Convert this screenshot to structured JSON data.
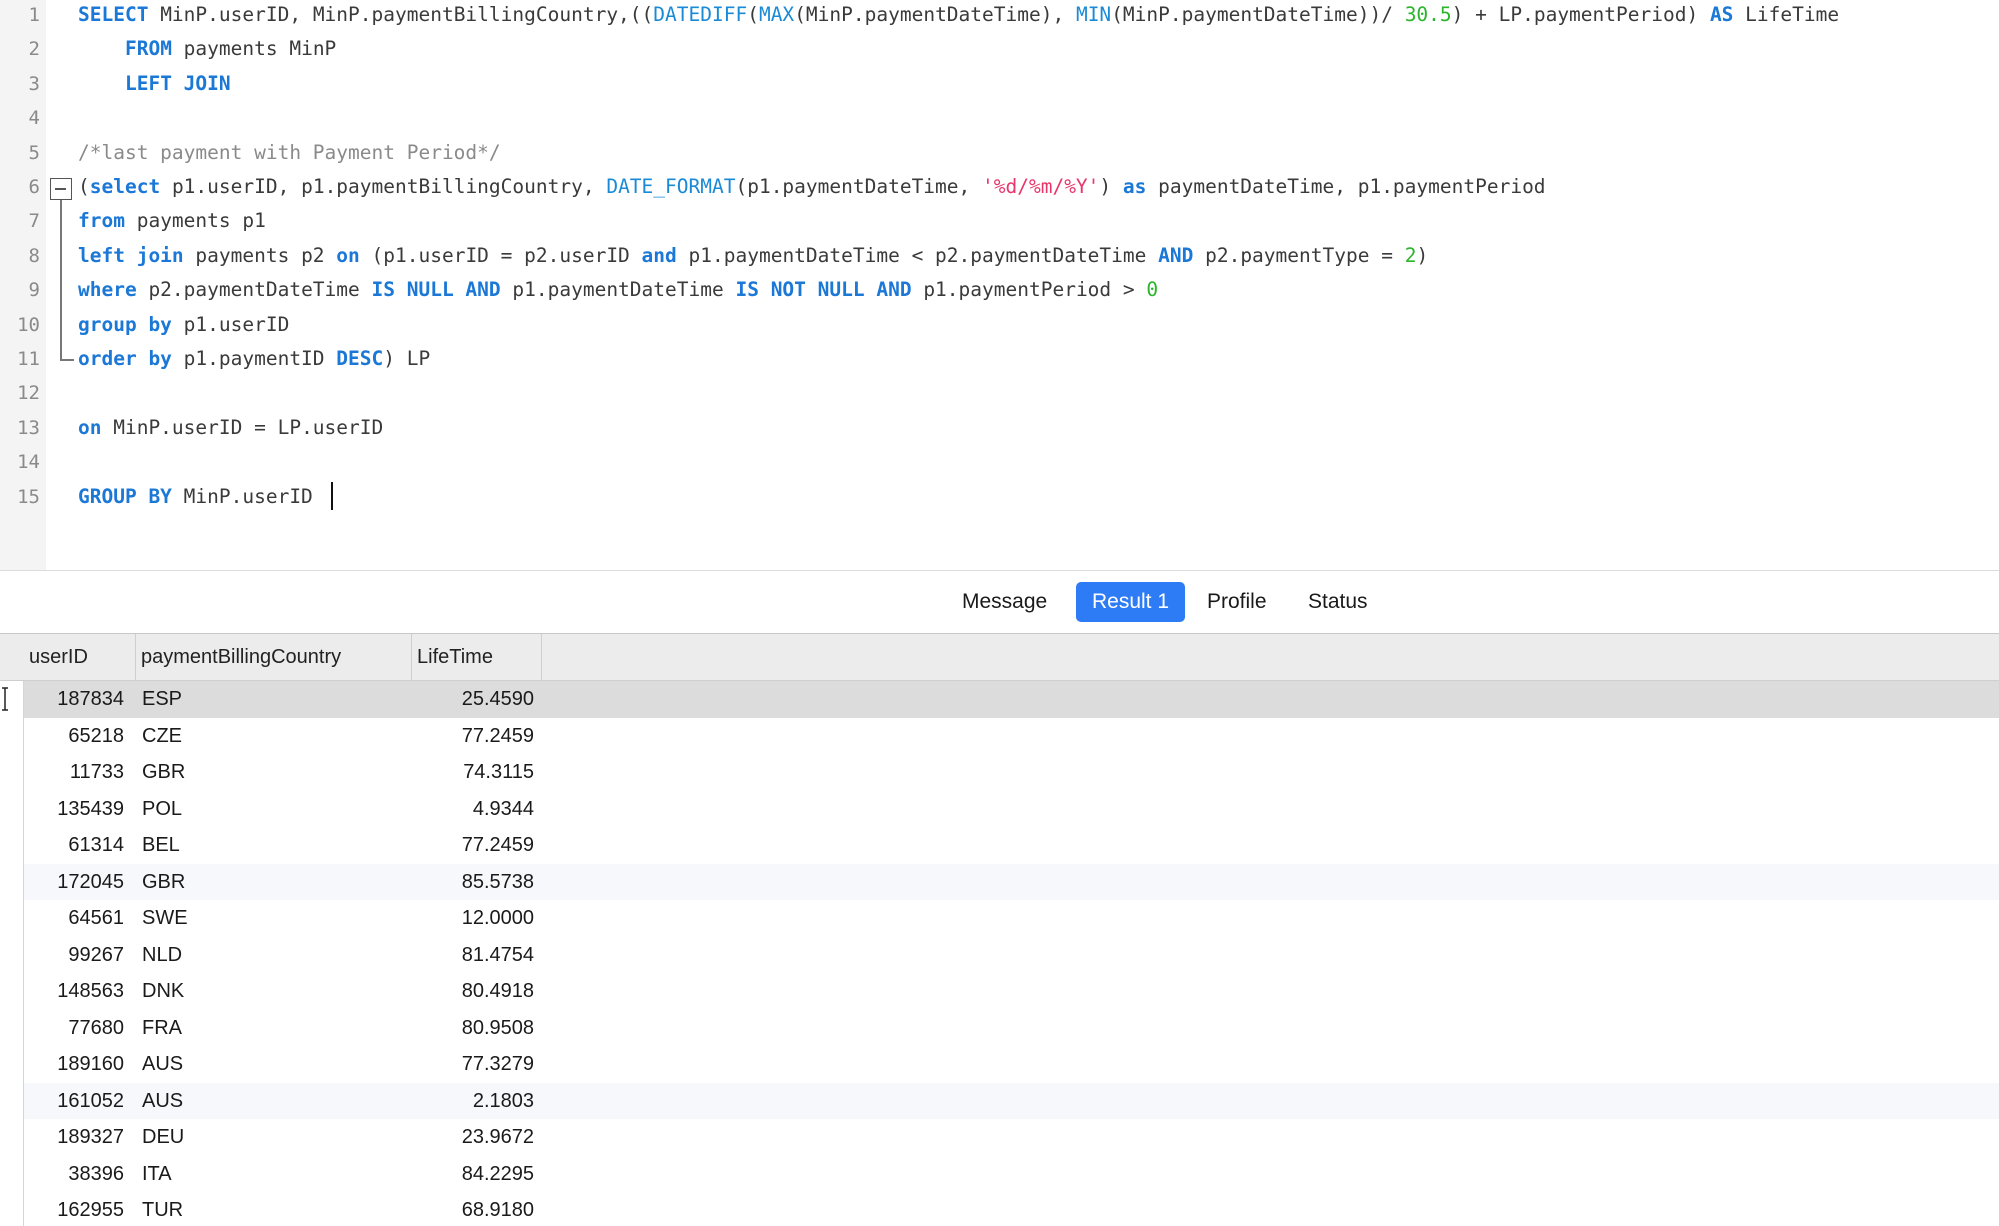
{
  "editor": {
    "line_numbers": [
      "1",
      "2",
      "3",
      "4",
      "5",
      "6",
      "7",
      "8",
      "9",
      "10",
      "11",
      "12",
      "13",
      "14",
      "15"
    ],
    "lines": [
      [
        {
          "t": "SELECT",
          "c": "kw"
        },
        {
          "t": " MinP.userID, MinP.paymentBillingCountry,((",
          "c": "pl"
        },
        {
          "t": "DATEDIFF",
          "c": "fn"
        },
        {
          "t": "(",
          "c": "pl"
        },
        {
          "t": "MAX",
          "c": "fn"
        },
        {
          "t": "(MinP.paymentDateTime), ",
          "c": "pl"
        },
        {
          "t": "MIN",
          "c": "fn"
        },
        {
          "t": "(MinP.paymentDateTime))/ ",
          "c": "pl"
        },
        {
          "t": "30.5",
          "c": "num"
        },
        {
          "t": ") + LP.paymentPeriod) ",
          "c": "pl"
        },
        {
          "t": "AS",
          "c": "kw"
        },
        {
          "t": " LifeTime",
          "c": "pl"
        }
      ],
      [
        {
          "t": "    ",
          "c": "pl"
        },
        {
          "t": "FROM",
          "c": "kw"
        },
        {
          "t": " payments MinP",
          "c": "pl"
        }
      ],
      [
        {
          "t": "    ",
          "c": "pl"
        },
        {
          "t": "LEFT JOIN",
          "c": "kw"
        }
      ],
      [],
      [
        {
          "t": "/*last payment with Payment Period*/",
          "c": "cm"
        }
      ],
      [
        {
          "t": "(",
          "c": "pl"
        },
        {
          "t": "select",
          "c": "kw"
        },
        {
          "t": " p1.userID, p1.paymentBillingCountry, ",
          "c": "pl"
        },
        {
          "t": "DATE_FORMAT",
          "c": "fn"
        },
        {
          "t": "(p1.paymentDateTime, ",
          "c": "pl"
        },
        {
          "t": "'%d/%m/%Y'",
          "c": "str"
        },
        {
          "t": ") ",
          "c": "pl"
        },
        {
          "t": "as",
          "c": "kw"
        },
        {
          "t": " paymentDateTime, p1.paymentPeriod",
          "c": "pl"
        }
      ],
      [
        {
          "t": "from",
          "c": "kw"
        },
        {
          "t": " payments p1",
          "c": "pl"
        }
      ],
      [
        {
          "t": "left join",
          "c": "kw"
        },
        {
          "t": " payments p2 ",
          "c": "pl"
        },
        {
          "t": "on",
          "c": "kw"
        },
        {
          "t": " (p1.userID = p2.userID ",
          "c": "pl"
        },
        {
          "t": "and",
          "c": "kw"
        },
        {
          "t": " p1.paymentDateTime < p2.paymentDateTime ",
          "c": "pl"
        },
        {
          "t": "AND",
          "c": "kw"
        },
        {
          "t": " p2.paymentType = ",
          "c": "pl"
        },
        {
          "t": "2",
          "c": "num"
        },
        {
          "t": ")",
          "c": "pl"
        }
      ],
      [
        {
          "t": "where",
          "c": "kw"
        },
        {
          "t": " p2.paymentDateTime ",
          "c": "pl"
        },
        {
          "t": "IS NULL AND",
          "c": "kw"
        },
        {
          "t": " p1.paymentDateTime ",
          "c": "pl"
        },
        {
          "t": "IS NOT NULL AND",
          "c": "kw"
        },
        {
          "t": " p1.paymentPeriod > ",
          "c": "pl"
        },
        {
          "t": "0",
          "c": "num"
        }
      ],
      [
        {
          "t": "group by",
          "c": "kw"
        },
        {
          "t": " p1.userID",
          "c": "pl"
        }
      ],
      [
        {
          "t": "order by",
          "c": "kw"
        },
        {
          "t": " p1.paymentID ",
          "c": "pl"
        },
        {
          "t": "DESC",
          "c": "kw"
        },
        {
          "t": ") LP",
          "c": "pl"
        }
      ],
      [],
      [
        {
          "t": "on",
          "c": "kw"
        },
        {
          "t": " MinP.userID = LP.userID",
          "c": "pl"
        }
      ],
      [],
      [
        {
          "t": "GROUP BY",
          "c": "kw"
        },
        {
          "t": " MinP.userID",
          "c": "pl"
        }
      ]
    ]
  },
  "tabs": {
    "message": "Message",
    "result1": "Result 1",
    "profile": "Profile",
    "status": "Status",
    "active": "result1"
  },
  "results": {
    "columns": [
      "userID",
      "paymentBillingCountry",
      "LifeTime"
    ],
    "rows": [
      [
        "187834",
        "ESP",
        "25.4590"
      ],
      [
        "65218",
        "CZE",
        "77.2459"
      ],
      [
        "11733",
        "GBR",
        "74.3115"
      ],
      [
        "135439",
        "POL",
        "4.9344"
      ],
      [
        "61314",
        "BEL",
        "77.2459"
      ],
      [
        "172045",
        "GBR",
        "85.5738"
      ],
      [
        "64561",
        "SWE",
        "12.0000"
      ],
      [
        "99267",
        "NLD",
        "81.4754"
      ],
      [
        "148563",
        "DNK",
        "80.4918"
      ],
      [
        "77680",
        "FRA",
        "80.9508"
      ],
      [
        "189160",
        "AUS",
        "77.3279"
      ],
      [
        "161052",
        "AUS",
        "2.1803"
      ],
      [
        "189327",
        "DEU",
        "23.9672"
      ],
      [
        "38396",
        "ITA",
        "84.2295"
      ],
      [
        "162955",
        "TUR",
        "68.9180"
      ]
    ],
    "selected_row": 0
  },
  "colors": {
    "accent": "#2d7cf6",
    "keyword": "#1b78d6",
    "number": "#2ab52a",
    "string": "#e8356a",
    "comment": "#8a8a8a"
  }
}
